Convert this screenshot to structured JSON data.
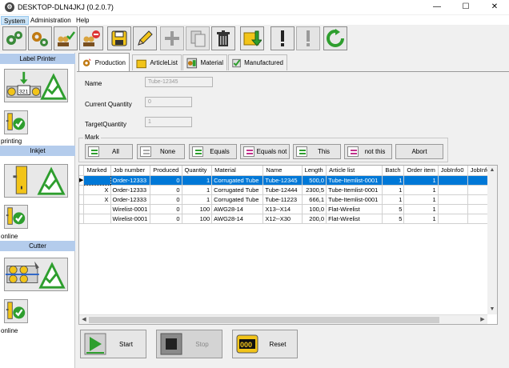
{
  "window": {
    "title": "DESKTOP-DLN4JKJ (0.2.0.7)",
    "minimize": "—",
    "maximize": "☐",
    "close": "✕"
  },
  "menu": [
    "System",
    "Administration",
    "Help"
  ],
  "left_panel": {
    "label_printer": {
      "header": "Label Printer",
      "counter": "321",
      "status": "printing"
    },
    "inkjet": {
      "header": "Inkjet",
      "status": "online"
    },
    "cutter": {
      "header": "Cutter",
      "status": "online"
    }
  },
  "tabs": [
    "Production",
    "ArticleList",
    "Material",
    "Manufactured"
  ],
  "form": {
    "name_label": "Name",
    "name_value": "Tube-12345",
    "current_quantity_label": "Current Quantity",
    "current_quantity_value": "0",
    "target_quantity_label": "TargetQuantity",
    "target_quantity_value": "1"
  },
  "mark": {
    "group_label": "Mark",
    "buttons": [
      "All",
      "None",
      "Equals",
      "Equals not",
      "This",
      "not this",
      "Abort"
    ]
  },
  "table": {
    "columns": [
      "Marked",
      "Job number",
      "Produced",
      "Quantity",
      "Material",
      "Name",
      "Length",
      "Article list",
      "Batch",
      "Order item",
      "JobInfo0",
      "JobInfo"
    ],
    "rows": [
      [
        "",
        "Order-12333",
        "0",
        "1",
        "Corrugated Tube",
        "Tube-12345",
        "500,0",
        "Tube-Itemlist-0001",
        "1",
        "1",
        "",
        ""
      ],
      [
        "X",
        "Order-12333",
        "0",
        "1",
        "Corrugated Tube",
        "Tube-12444",
        "2300,5",
        "Tube-Itemlist-0001",
        "1",
        "1",
        "",
        ""
      ],
      [
        "X",
        "Order-12333",
        "0",
        "1",
        "Corrugated Tube",
        "Tube-11223",
        "666,1",
        "Tube-Itemlist-0001",
        "1",
        "1",
        "",
        ""
      ],
      [
        "",
        "Wirelist-0001",
        "0",
        "100",
        "AWG28-14",
        "X13--X14",
        "100,0",
        "Flat-Wirelist",
        "5",
        "1",
        "",
        ""
      ],
      [
        "",
        "Wirelist-0001",
        "0",
        "100",
        "AWG28-14",
        "X12--X30",
        "200,0",
        "Flat-Wirelist",
        "5",
        "1",
        "",
        ""
      ]
    ],
    "selected_row": 0
  },
  "actions": [
    "Start",
    "Stop",
    "Reset"
  ],
  "reset_counter": "000",
  "colors": {
    "selection": "#0078d7",
    "section_header": "#b4ccec",
    "green": "#2e9e2e",
    "yellow": "#f2c419"
  }
}
